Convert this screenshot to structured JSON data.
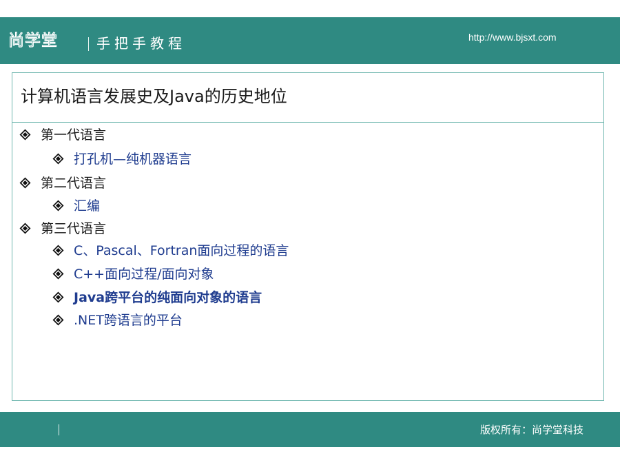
{
  "header": {
    "logo_text": "尚学堂",
    "tagline": "手把手教程",
    "url": "http://www.bjsxt.com"
  },
  "slide": {
    "title": "计算机语言发展史及Java的历史地位",
    "bullets": [
      {
        "text": "第一代语言",
        "level": 1
      },
      {
        "text": "打孔机—纯机器语言",
        "level": 2
      },
      {
        "text": "第二代语言",
        "level": 1
      },
      {
        "text": "汇编",
        "level": 2
      },
      {
        "text": "第三代语言",
        "level": 1
      },
      {
        "text": "C、Pascal、Fortran面向过程的语言",
        "level": 2
      },
      {
        "text": "C++面向过程/面向对象",
        "level": 2
      },
      {
        "text": "Java跨平台的纯面向对象的语言",
        "level": 2,
        "bold": true
      },
      {
        "text": ".NET跨语言的平台",
        "level": 2
      }
    ],
    "bullet_icon": "diamond-bullet-icon"
  },
  "footer": {
    "copyright": "版权所有：尚学堂科技"
  },
  "colors": {
    "teal": "#2f8a82",
    "frame_line": "#6cb5ad",
    "level2_text": "#1f3c8f",
    "level1_text": "#1a1a1a"
  }
}
